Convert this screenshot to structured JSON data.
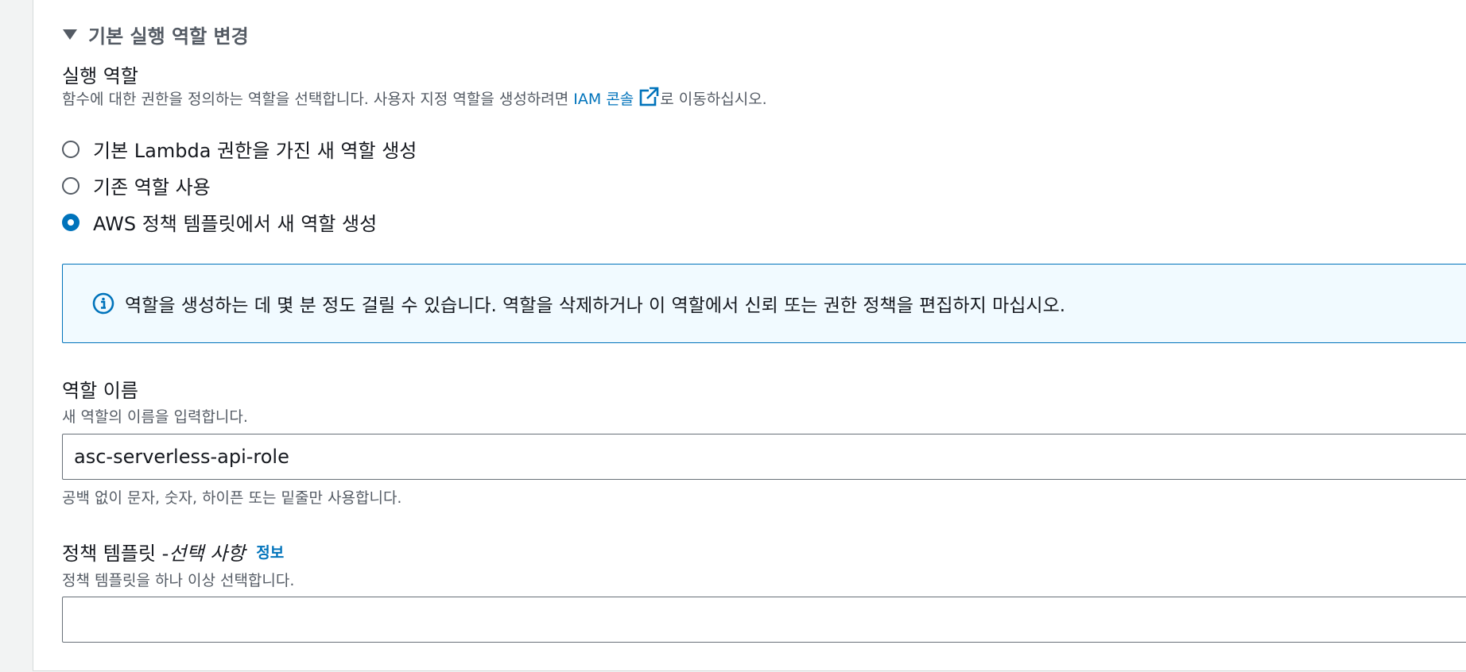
{
  "section": {
    "expander_title": "기본 실행 역할 변경"
  },
  "execution_role": {
    "label": "실행 역할",
    "description_before": "함수에 대한 권한을 정의하는 역할을 선택합니다. 사용자 지정 역할을 생성하려면 ",
    "iam_console_link": "IAM 콘솔",
    "description_after": "로 이동하십시오.",
    "options": [
      {
        "label": "기본 Lambda 권한을 가진 새 역할 생성",
        "checked": false
      },
      {
        "label": "기존 역할 사용",
        "checked": false
      },
      {
        "label": "AWS 정책 템플릿에서 새 역할 생성",
        "checked": true
      }
    ]
  },
  "info_alert": {
    "icon": "info-icon",
    "text": "역할을 생성하는 데 몇 분 정도 걸릴 수 있습니다. 역할을 삭제하거나 이 역할에서 신뢰 또는 권한 정책을 편집하지 마십시오."
  },
  "role_name": {
    "label": "역할 이름",
    "description": "새 역할의 이름을 입력합니다.",
    "value": "asc-serverless-api-role",
    "constraint": "공백 없이 문자, 숫자, 하이픈 또는 밑줄만 사용합니다."
  },
  "policy_templates": {
    "label": "정책 템플릿 - ",
    "optional": "선택 사항",
    "info_link": "정보",
    "description": "정책 템플릿을 하나 이상 선택합니다.",
    "value": ""
  },
  "colors": {
    "link": "#0073bb",
    "info_bg": "#f1faff",
    "text": "#16191f",
    "muted": "#545b64"
  }
}
